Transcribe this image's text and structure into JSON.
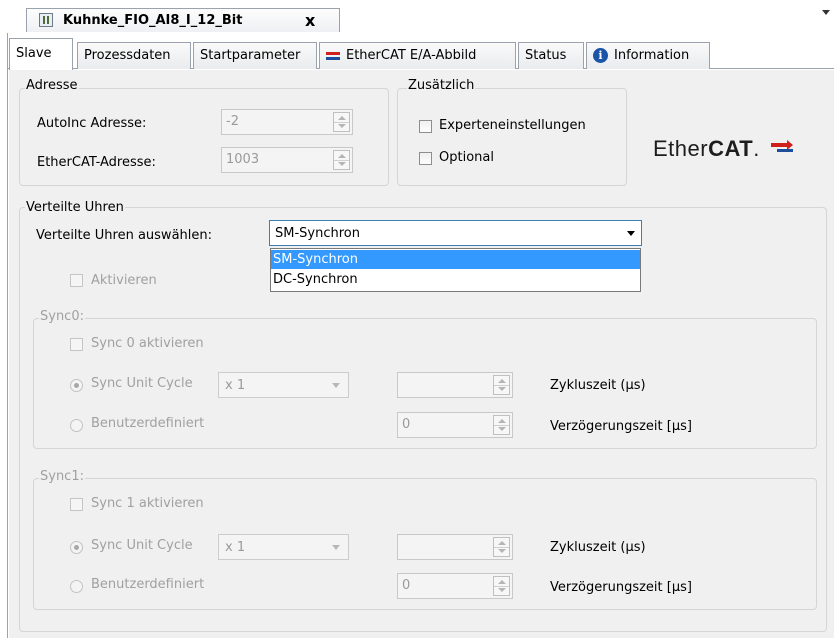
{
  "document": {
    "title": "Kuhnke_FIO_AI8_I_12_Bit",
    "close_glyph": "x",
    "icon": "device-icon"
  },
  "tabs": [
    {
      "label": "Slave",
      "active": true
    },
    {
      "label": "Prozessdaten"
    },
    {
      "label": "Startparameter"
    },
    {
      "label": "EtherCAT E/A-Abbild",
      "icon": "ethercat-io-icon"
    },
    {
      "label": "Status"
    },
    {
      "label": "Information",
      "icon": "info-icon"
    }
  ],
  "adresse": {
    "title": "Adresse",
    "autoinc_label": "AutoInc Adresse:",
    "autoinc_value": "-2",
    "ethercat_label": "EtherCAT-Adresse:",
    "ethercat_value": "1003"
  },
  "zusaetzlich": {
    "title": "Zusätzlich",
    "experten_label": "Experteneinstellungen",
    "optional_label": "Optional"
  },
  "logo": {
    "text_a": "Ether",
    "text_b": "CAT",
    "suffix": ".",
    "colors": {
      "red": "#d0201b",
      "blue": "#1d4e9e"
    }
  },
  "verteilte_uhren": {
    "title": "Verteilte Uhren",
    "select_label": "Verteilte Uhren auswählen:",
    "selected": "SM-Synchron",
    "options": [
      "SM-Synchron",
      "DC-Synchron"
    ],
    "aktivieren_label": "Aktivieren"
  },
  "sync0": {
    "title": "Sync0:",
    "activate_label": "Sync 0 aktivieren",
    "unit_cycle_label": "Sync Unit Cycle",
    "unit_cycle_value": "x 1",
    "benutzer_label": "Benutzerdefiniert",
    "zyklus_label": "Zykluszeit (µs)",
    "zyklus_value": "",
    "verzoegerung_label": "Verzögerungszeit [µs]",
    "verzoegerung_value": "0"
  },
  "sync1": {
    "title": "Sync1:",
    "activate_label": "Sync 1 aktivieren",
    "unit_cycle_label": "Sync Unit Cycle",
    "unit_cycle_value": "x 1",
    "benutzer_label": "Benutzerdefiniert",
    "zyklus_label": "Zykluszeit (µs)",
    "zyklus_value": "",
    "verzoegerung_label": "Verzögerungszeit [µs]",
    "verzoegerung_value": "0"
  }
}
